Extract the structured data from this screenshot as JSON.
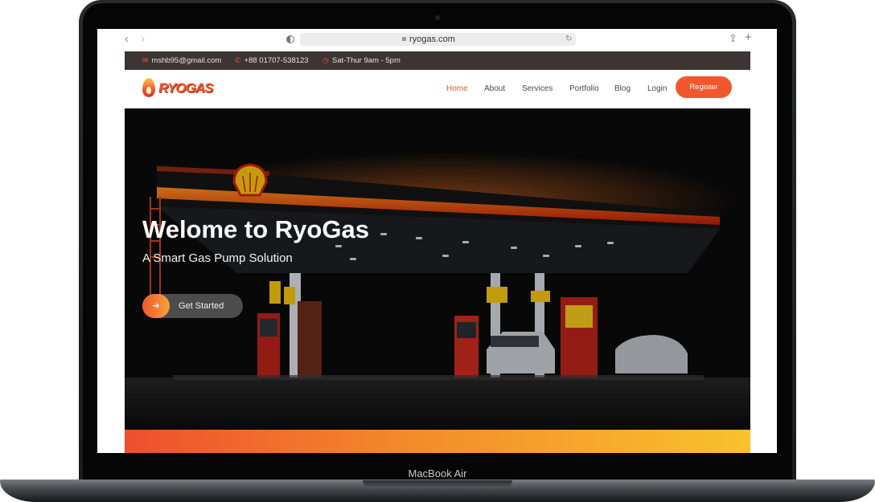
{
  "browser": {
    "url": "ryogas.com",
    "back_icon": "‹",
    "forward_icon": "›",
    "reload_icon": "↻",
    "share_icon": "⇪",
    "new_tab_icon": "+"
  },
  "topbar": {
    "email": "mshb95@gmail.com",
    "phone": "+88 01707-538123",
    "hours": "Sat-Thur 9am - 5pm",
    "email_icon": "✉",
    "phone_icon": "✆",
    "clock_icon": "◷"
  },
  "brand": {
    "name": "RYOGAS",
    "color": "#f0582c"
  },
  "nav": {
    "links": [
      "Home",
      "About",
      "Services",
      "Portfolio",
      "Blog",
      "Login"
    ],
    "active": "Home",
    "register": "Register"
  },
  "hero": {
    "title": "Welome to RyoGas",
    "subtitle": "A Smart Gas Pump Solution",
    "cta_label": "Get Started",
    "cta_icon": "➜"
  },
  "device": {
    "label": "MacBook Air"
  },
  "colors": {
    "accent": "#f0582c",
    "topbar_bg": "#3d3434",
    "gradient_start": "#ee4f2e",
    "gradient_end": "#f9c22d"
  }
}
